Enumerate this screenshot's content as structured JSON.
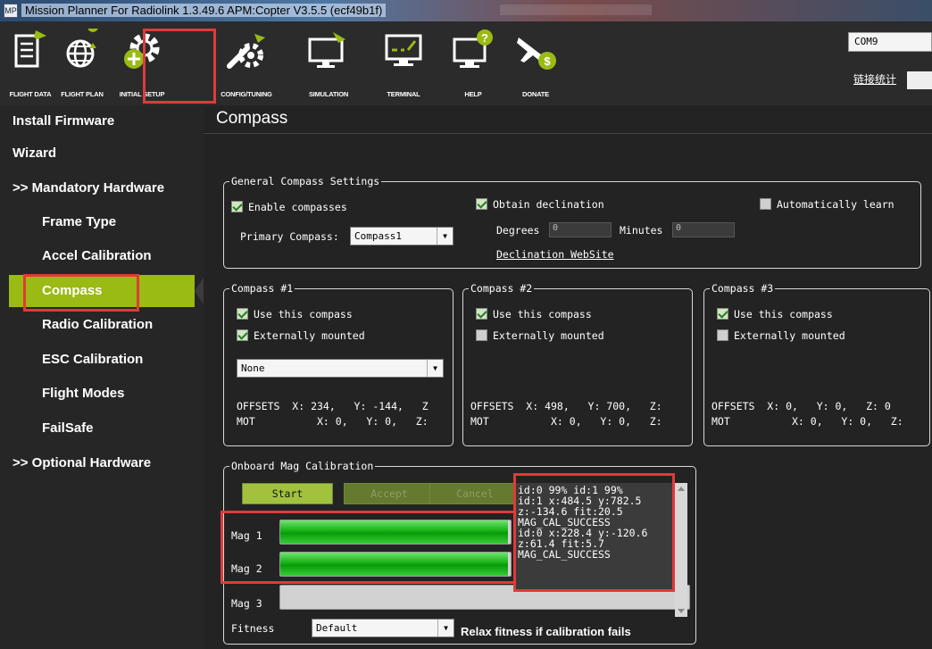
{
  "window": {
    "app_icon": "MP",
    "title": "Mission Planner For Radiolink 1.3.49.6 APM:Copter V3.5.5 (ecf49b1f)"
  },
  "toolbar": {
    "buttons": [
      {
        "label": "FLIGHT DATA",
        "icon": "flight-data-icon"
      },
      {
        "label": "FLIGHT PLAN",
        "icon": "flight-plan-icon"
      },
      {
        "label": "INITIAL SETUP",
        "icon": "initial-setup-icon"
      },
      {
        "label": "CONFIG/TUNING",
        "icon": "config-tuning-icon"
      },
      {
        "label": "SIMULATION",
        "icon": "simulation-icon"
      },
      {
        "label": "TERMINAL",
        "icon": "terminal-icon"
      },
      {
        "label": "HELP",
        "icon": "help-icon"
      },
      {
        "label": "DONATE",
        "icon": "donate-icon"
      }
    ],
    "com_port": "COM9",
    "link_stats": "链接统计"
  },
  "sidebar": {
    "items": [
      {
        "label": "Install Firmware"
      },
      {
        "label": "Wizard"
      },
      {
        "label": ">> Mandatory Hardware"
      },
      {
        "label": "Frame Type"
      },
      {
        "label": "Accel Calibration"
      },
      {
        "label": "Compass"
      },
      {
        "label": "Radio Calibration"
      },
      {
        "label": "ESC Calibration"
      },
      {
        "label": "Flight Modes"
      },
      {
        "label": "FailSafe"
      },
      {
        "label": ">> Optional Hardware"
      }
    ],
    "active": "Compass"
  },
  "page": {
    "title": "Compass"
  },
  "general": {
    "title": "General Compass Settings",
    "enable_compasses": "Enable compasses",
    "obtain_declination": "Obtain declination",
    "auto_learn": "Automatically learn",
    "primary_label": "Primary Compass:",
    "primary_value": "Compass1",
    "degrees_label": "Degrees",
    "degrees_value": "0",
    "minutes_label": "Minutes",
    "minutes_value": "0",
    "decl_link": "Declination WebSite"
  },
  "compasses": [
    {
      "title": "Compass #1",
      "use": "Use this compass",
      "ext": "Externally mounted",
      "orientation": "None",
      "offsets": "OFFSETS  X: 234,   Y: -144,   Z",
      "mot": "MOT          X: 0,   Y: 0,   Z:"
    },
    {
      "title": "Compass #2",
      "use": "Use this compass",
      "ext": "Externally mounted",
      "offsets": "OFFSETS  X: 498,   Y: 700,   Z:",
      "mot": "MOT          X: 0,   Y: 0,   Z:"
    },
    {
      "title": "Compass #3",
      "use": "Use this compass",
      "ext": "Externally mounted",
      "offsets": "OFFSETS  X: 0,   Y: 0,   Z: 0",
      "mot": "MOT          X: 0,   Y: 0,   Z:"
    }
  ],
  "onboard": {
    "title": "Onboard Mag Calibration",
    "start": "Start",
    "accept": "Accept",
    "cancel": "Cancel",
    "mags": [
      {
        "label": "Mag 1",
        "progress": 0.99
      },
      {
        "label": "Mag 2",
        "progress": 0.99
      },
      {
        "label": "Mag 3",
        "progress": 0
      }
    ],
    "log": "id:0 99% id:1 99%\nid:1 x:484.5 y:782.5\nz:-134.6 fit:20.5\nMAG_CAL_SUCCESS\nid:0 x:228.4 y:-120.6\nz:61.4 fit:5.7\nMAG_CAL_SUCCESS",
    "fitness_label": "Fitness",
    "fitness_value": "Default",
    "relax": "Relax fitness if calibration fails"
  },
  "colors": {
    "accent": "#9aba14",
    "highlight": "#e03a3a",
    "progress": "#14b014"
  }
}
